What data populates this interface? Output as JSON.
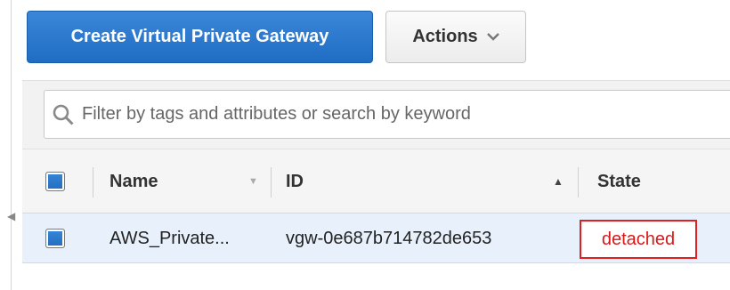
{
  "toolbar": {
    "create_label": "Create Virtual Private Gateway",
    "actions_label": "Actions"
  },
  "search": {
    "placeholder": "Filter by tags and attributes or search by keyword",
    "value": ""
  },
  "table": {
    "columns": [
      "Name",
      "ID",
      "State"
    ],
    "rows": [
      {
        "name": "AWS_Private...",
        "id": "vgw-0e687b714782de653",
        "state": "detached",
        "selected": true
      }
    ]
  },
  "icons": {
    "search": "search-icon",
    "actions_dropdown": "chevron-down-icon",
    "name_sort": "sort-down-icon",
    "id_sort": "sort-up-icon"
  },
  "colors": {
    "primary": "#1f6dc4",
    "state_detached": "#d81818",
    "selected_row": "#e8f1fb"
  }
}
